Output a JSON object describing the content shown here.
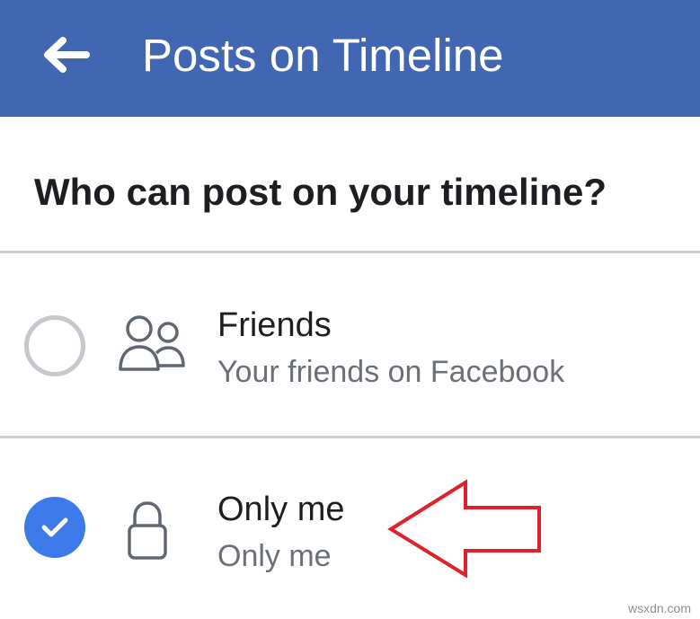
{
  "header": {
    "title": "Posts on Timeline",
    "back_icon": "arrow-left-icon",
    "background_color": "#4267b2"
  },
  "question": "Who can post on your timeline?",
  "options": [
    {
      "title": "Friends",
      "subtitle": "Your friends on Facebook",
      "icon": "friends-icon",
      "selected": false
    },
    {
      "title": "Only me",
      "subtitle": "Only me",
      "icon": "lock-icon",
      "selected": true
    }
  ],
  "annotation": {
    "icon": "red-arrow-left",
    "color": "#e0202a"
  },
  "colors": {
    "selected_radio": "#3b7ae8",
    "unselected_radio": "#c5c8cd",
    "divider": "#cdd0d4"
  },
  "watermark": "wsxdn.com"
}
